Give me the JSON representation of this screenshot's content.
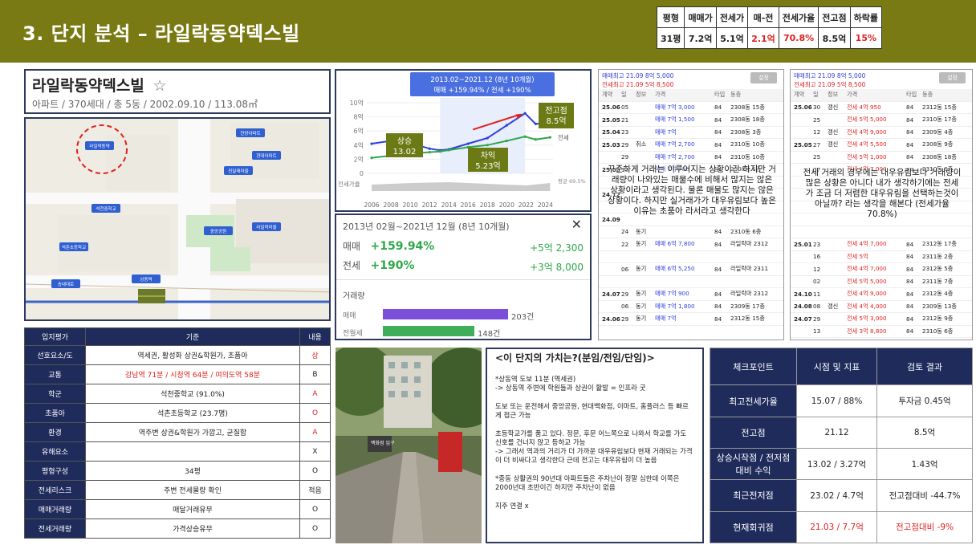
{
  "header": {
    "title": "3. 단지 분석 – 라일락동약덱스빌"
  },
  "summary": {
    "headers": [
      "평형",
      "매매가",
      "전세가",
      "매-전",
      "전세가율",
      "전고점",
      "하락률"
    ],
    "values": [
      "31평",
      "7.2억",
      "5.1억",
      "2.1억",
      "70.8%",
      "8.5억",
      "15%"
    ]
  },
  "complex": {
    "name": "라일락동약덱스빌",
    "star": "☆",
    "info": "아파트 / 370세대 / 총 5동 / 2002.09.10 / 113.08㎡"
  },
  "chart": {
    "banner_period": "2013.02~2021.12 (8년 10개월)",
    "banner_change": "매매 +159.94% / 전세 +190%",
    "yticks": [
      "10억",
      "8억",
      "6억",
      "4억",
      "2억",
      "0"
    ],
    "ylabel_jeonse": "전세가율",
    "xticks": [
      "2006",
      "2008",
      "2010",
      "2012",
      "2014",
      "2016",
      "2018",
      "2020",
      "2022",
      "2024"
    ],
    "label_jeonse": "전세",
    "label_ratio": "평균 69.5%",
    "ann_rise_title": "상승",
    "ann_rise_value": "13.02",
    "ann_gap_title": "차익",
    "ann_gap_value": "5.23억",
    "ann_peak_title": "전고점",
    "ann_peak_value": "8.5억"
  },
  "chart_data": {
    "type": "line",
    "x": [
      2006,
      2008,
      2010,
      2012,
      2013.1,
      2014,
      2016,
      2018,
      2020,
      2021.9,
      2023,
      2024.5
    ],
    "series": [
      {
        "name": "매매",
        "values": [
          4.2,
          4.6,
          4.3,
          3.5,
          3.27,
          3.4,
          4.2,
          5.0,
          6.8,
          8.5,
          7.0,
          7.2
        ]
      },
      {
        "name": "전세",
        "values": [
          2.2,
          2.5,
          2.8,
          3.0,
          3.1,
          3.3,
          3.7,
          4.0,
          4.6,
          5.2,
          4.8,
          5.1
        ]
      }
    ],
    "ylim": [
      0,
      10
    ]
  },
  "stats": {
    "period": "2013년 02월~2021년 12월 (8년 10개월)",
    "close": "✕",
    "sale_label": "매매",
    "sale_pct": "+159.94%",
    "sale_amt": "+5억 2,300",
    "jeonse_label": "전세",
    "jeonse_pct": "+190%",
    "jeonse_amt": "+3억 8,000",
    "volume_title": "거래량",
    "vol_sale_label": "매매",
    "vol_sale_count": "203건",
    "vol_sale_frac": 0.78,
    "vol_jw_label": "전월세",
    "vol_jw_count": "148건",
    "vol_jw_frac": 0.57
  },
  "listing1": {
    "h1": "매매최고 21.09 8억 5,000",
    "h2": "전세최고 21.09 5억 8,500",
    "btn": "설정",
    "cols": [
      "계약",
      "일",
      "정보",
      "가격",
      "타입",
      "동층"
    ],
    "rows": [
      [
        "25.06",
        "05",
        "",
        "매매 7억 3,000",
        "84",
        "2308동 15층"
      ],
      [
        "25.05",
        "21",
        "",
        "매매 7억 1,500",
        "84",
        "2308동 18층"
      ],
      [
        "25.04",
        "23",
        "",
        "매매 7억",
        "84",
        "2308동 3층"
      ],
      [
        "25.03",
        "29",
        "취소",
        "매매 7억 2,700",
        "84",
        "2310동 10층"
      ],
      [
        "",
        "29",
        "",
        "매매 7억 2,700",
        "84",
        "2310동 10층"
      ],
      [
        "25.02",
        "15",
        "",
        "매매 7억 700",
        "84",
        "2308동 5층"
      ],
      [
        "",
        "",
        "",
        "",
        "",
        ""
      ],
      [
        "24.12",
        "",
        "",
        "",
        "",
        ""
      ],
      [
        "",
        "",
        "",
        "",
        "",
        ""
      ],
      [
        "24.09",
        "",
        "",
        "",
        "",
        ""
      ],
      [
        "",
        "24",
        "동기",
        "",
        "84",
        "2310동 6층"
      ],
      [
        "",
        "22",
        "동기",
        "매매 6억 7,800",
        "84",
        "라일락마 2312"
      ],
      [
        "",
        "",
        "",
        "",
        "",
        ""
      ],
      [
        "",
        "06",
        "동기",
        "매매 6억 5,250",
        "84",
        "라일락마 2311"
      ],
      [
        "",
        "",
        "",
        "",
        "",
        ""
      ],
      [
        "24.07",
        "29",
        "동기",
        "매매 7억 900",
        "84",
        "라일락마 2312"
      ],
      [
        "",
        "06",
        "동기",
        "매매 7억 1,800",
        "84",
        "2309동 17층"
      ],
      [
        "24.06",
        "29",
        "동기",
        "매매 7억",
        "84",
        "2312동 15층"
      ]
    ],
    "overlay": "꾸준하게 거래는 이루어지는 상황이긴 하지만 거래량이 나와있는 매물수에 비해서 많지는 않은 상황이라고 생각된다. 물론 매물도 많지는 않은 상황이다. 하지만 실거래가가 대우유림보다 높은 이유는 초품아 라서라고 생각한다"
  },
  "listing2": {
    "h1": "매매최고 21.09 8억 5,000",
    "h2": "전세최고 21.09 5억 8,500",
    "btn": "설정",
    "cols": [
      "계약",
      "일",
      "정보",
      "가격",
      "타입",
      "동층"
    ],
    "rows": [
      [
        "25.06",
        "30",
        "갱신",
        "전세 4억 950",
        "84",
        "2312동 15층"
      ],
      [
        "",
        "25",
        "",
        "전세 5억 5,000",
        "84",
        "2310동 17층"
      ],
      [
        "",
        "12",
        "갱신",
        "전세 4억 9,000",
        "84",
        "2309동 4층"
      ],
      [
        "25.05",
        "27",
        "갱신",
        "전세 4억 5,500",
        "84",
        "2308동 9층"
      ],
      [
        "",
        "25",
        "",
        "전세 5억 1,000",
        "84",
        "2308동 18층"
      ],
      [
        "",
        "07",
        "",
        "전세 4억 7,000",
        "84",
        "2310동 6층"
      ],
      [
        "",
        "",
        "",
        "",
        "",
        ""
      ],
      [
        "",
        "",
        "",
        "",
        "",
        ""
      ],
      [
        "",
        "",
        "",
        "",
        "",
        ""
      ],
      [
        "",
        "",
        "",
        "",
        "",
        ""
      ],
      [
        "",
        "",
        "",
        "",
        "",
        ""
      ],
      [
        "25.01",
        "23",
        "",
        "전세 4억 7,000",
        "84",
        "2312동 17층"
      ],
      [
        "",
        "16",
        "",
        "전세 5억",
        "84",
        "2311동 2층"
      ],
      [
        "",
        "12",
        "",
        "전세 4억 7,000",
        "84",
        "2312동 5층"
      ],
      [
        "",
        "02",
        "",
        "전세 5억 5,000",
        "84",
        "2311동 7층"
      ],
      [
        "24.10",
        "11",
        "",
        "전세 4억 9,000",
        "84",
        "2312동 4층"
      ],
      [
        "24.08",
        "08",
        "갱신",
        "전세 4억 4,000",
        "84",
        "2309동 13층"
      ],
      [
        "24.07",
        "29",
        "",
        "전세 5억 3,000",
        "84",
        "2312동 9층"
      ],
      [
        "",
        "13",
        "",
        "전세 3억 8,800",
        "84",
        "2310동 6층"
      ],
      [
        "24.06",
        "13",
        "갱신",
        "전세 5억",
        "84",
        "2309동 8층"
      ]
    ],
    "overlay": "전세 거래의 경우에는 대우유림보다 거래량이 많은 상황은 아니다 내가 생각하기에는 전세가 조금 더 저렴한 대우유림을 선택하는것이 아닐까? 라는 생각을 해본다 (전세가율 70.8%)"
  },
  "location": {
    "headers": [
      "입지평가",
      "기준",
      "내용"
    ],
    "rows": [
      {
        "k": "선호요소/도",
        "v": "역세권, 활성화 상권&학원가, 초품아",
        "r": "상",
        "red_v": false,
        "red_r": true
      },
      {
        "k": "교통",
        "v": "강남역 71분 / 시청역 64분 / 여의도역 58분",
        "r": "B",
        "red_v": true,
        "red_r": false
      },
      {
        "k": "학군",
        "v": "석천중학교 (91.0%)",
        "r": "A",
        "red_v": false,
        "red_r": true
      },
      {
        "k": "초품아",
        "v": "석촌초등학교 (23.7명)",
        "r": "O",
        "red_v": false,
        "red_r": true
      },
      {
        "k": "환경",
        "v": "역주변 상권&학원가 가깝고, 균질함",
        "r": "A",
        "red_v": false,
        "red_r": true
      },
      {
        "k": "유해요소",
        "v": "",
        "r": "X",
        "red_v": false,
        "red_r": false
      },
      {
        "k": "평형구성",
        "v": "34평",
        "r": "O",
        "red_v": false,
        "red_r": false
      },
      {
        "k": "전세리스크",
        "v": "주변 전세물량 확인",
        "r": "적음",
        "red_v": false,
        "red_r": false
      },
      {
        "k": "매매거래량",
        "v": "매달거래유무",
        "r": "O",
        "red_v": false,
        "red_r": false
      },
      {
        "k": "전세거래량",
        "v": "가격상승유무",
        "r": "O",
        "red_v": false,
        "red_r": false
      }
    ]
  },
  "value": {
    "title": "<이 단지의 가치는?(분임/전임/단임)>",
    "p1": "*상동역 도보 11분 (역세권)\n-> 상동역 주변에 학원들과 상권이 활발 = 인프라 굿",
    "p2": "도보 또는 운전해서 중앙공원, 현대백화점, 이마트, 홈플러스 등 빠르게 접근 가능",
    "p3": "초등학교가를 품고 있다. 정문, 후문 어느쪽으로 나와서 학교를 가도 신호를 건너지 않고 등하교 가능\n-> 그래서 역과의 거리가 더 가까운 대우유림보다 현재 거래되는 가격이 더 비싸다고 생각한다 근데 전고는 대우유림이 더 높음",
    "p4": "*중동 상활권의 90년대 아파트들은 주차난이 정말 심한데 이쪽은 2000년대 초반이긴 하지만 주차난이 없음",
    "p5": "지주 연결 x"
  },
  "checkpoint": {
    "headers": [
      "체크포인트",
      "시점 및 지표",
      "검토 결과"
    ],
    "rows": [
      {
        "k": "최고전세가율",
        "a": "15.07 / 88%",
        "b": "투자금 0.45억",
        "red": false
      },
      {
        "k": "전고점",
        "a": "21.12",
        "b": "8.5억",
        "red": false
      },
      {
        "k": "상승시작점 / 전저점대비 수익",
        "a": "13.02 / 3.27억",
        "b": "1.43억",
        "red": false
      },
      {
        "k": "최근전저점",
        "a": "23.02 / 4.7억",
        "b": "전고점대비 -44.7%",
        "red": false
      },
      {
        "k": "현재회귀점",
        "a": "21.03 / 7.7억",
        "b": "전고점대비 -9%",
        "red": true
      }
    ]
  },
  "map": {
    "labels": [
      "라일락동약",
      "한양아파트",
      "현대아파트",
      "진달래마을",
      "중앙공원",
      "상동역",
      "석천중학교",
      "라일락마을",
      "송내대로",
      "석촌초등학교"
    ]
  },
  "photo": {
    "sign": "백화점 입구"
  },
  "colors": {
    "header_bg": "#7a7a14",
    "navy": "#1f2b5b",
    "red": "#e02020",
    "sale": "#2f3fd8",
    "jeonse": "#2ea84a"
  }
}
